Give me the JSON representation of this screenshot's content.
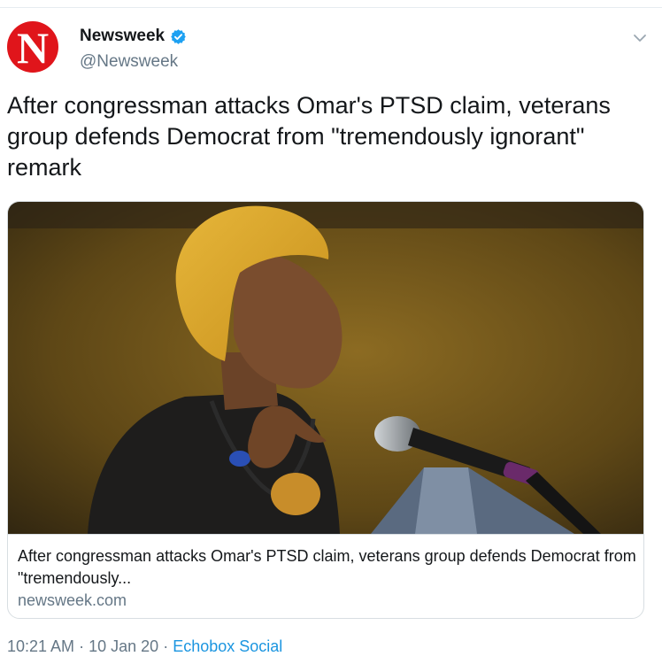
{
  "tweet": {
    "avatar_letter": "N",
    "display_name": "Newsweek",
    "handle": "@Newsweek",
    "verified": true,
    "text": "After congressman attacks Omar's PTSD claim, veterans group defends Democrat from \"tremendously ignorant\" remark",
    "menu_icon": "chevron-down-icon"
  },
  "card": {
    "image_subject": "photo of a woman in a mustard yellow head wrap speaking at a microphone",
    "title": "After congressman attacks Omar's PTSD claim, veterans group defends Democrat from \"tremendously...",
    "domain": "newsweek.com"
  },
  "meta": {
    "time": "10:21 AM",
    "separator": "·",
    "date": "10 Jan 20",
    "source": "Echobox Social"
  },
  "colors": {
    "brand_red": "#e0151b",
    "verified_blue": "#1da1f2",
    "link_blue": "#1b95e0",
    "secondary_text": "#657786"
  }
}
